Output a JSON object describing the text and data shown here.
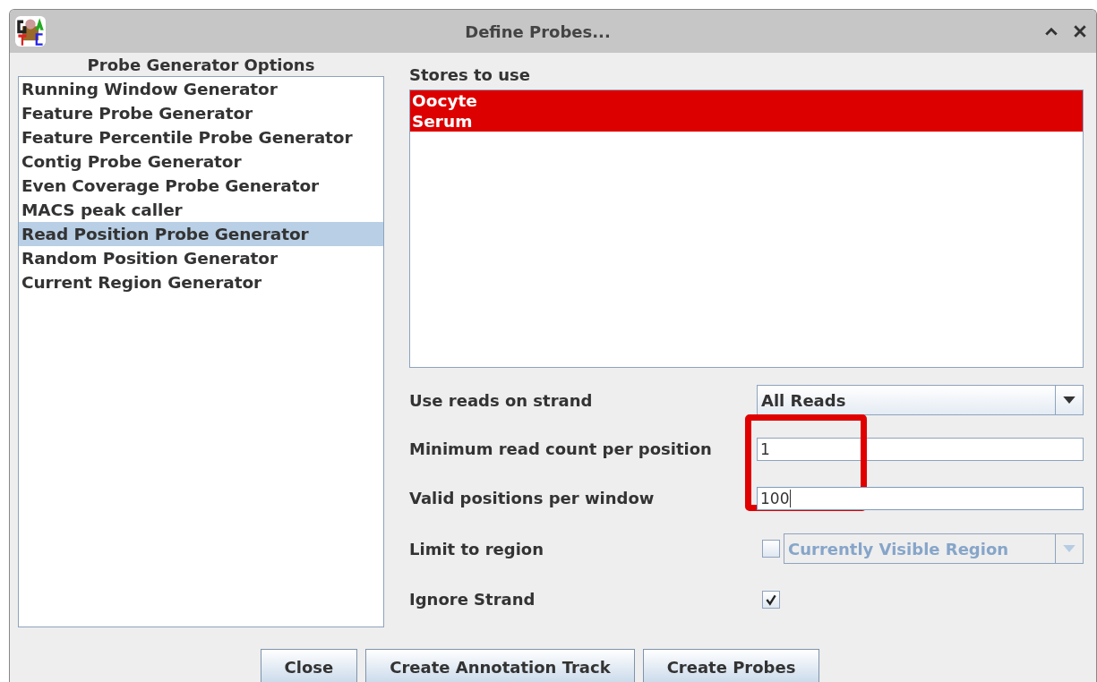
{
  "window": {
    "title": "Define Probes..."
  },
  "generator_panel": {
    "title": "Probe Generator Options",
    "items": [
      {
        "label": "Running Window Generator",
        "selected": false
      },
      {
        "label": "Feature Probe Generator",
        "selected": false
      },
      {
        "label": "Feature Percentile Probe Generator",
        "selected": false
      },
      {
        "label": "Contig Probe Generator",
        "selected": false
      },
      {
        "label": "Even Coverage Probe Generator",
        "selected": false
      },
      {
        "label": "MACS peak caller",
        "selected": false
      },
      {
        "label": "Read Position Probe Generator",
        "selected": true
      },
      {
        "label": "Random Position Generator",
        "selected": false
      },
      {
        "label": "Current Region Generator",
        "selected": false
      }
    ]
  },
  "stores": {
    "label": "Stores to use",
    "items": [
      {
        "label": "Oocyte",
        "selected": true
      },
      {
        "label": "Serum",
        "selected": true
      }
    ]
  },
  "options": [
    {
      "kind": "dropdown",
      "label": "Use reads on strand",
      "value": "All Reads",
      "disabled": false
    },
    {
      "kind": "text",
      "label": "Minimum read count per position",
      "value": "1",
      "focused": false,
      "highlighted": true
    },
    {
      "kind": "text",
      "label": "Valid positions per window",
      "value": "100",
      "focused": true,
      "highlighted": true
    },
    {
      "kind": "check-dropdown",
      "label": "Limit to region",
      "checked": false,
      "value": "Currently Visible Region",
      "disabled": true
    },
    {
      "kind": "check",
      "label": "Ignore Strand",
      "checked": true
    }
  ],
  "buttons": [
    "Close",
    "Create Annotation Track",
    "Create Probes"
  ]
}
